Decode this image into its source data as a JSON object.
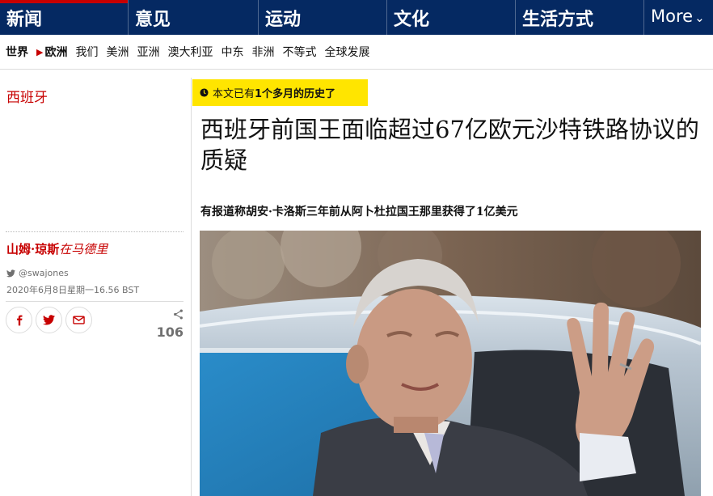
{
  "topnav": {
    "pillars": [
      {
        "label": "新闻",
        "active": true
      },
      {
        "label": "意见",
        "active": false
      },
      {
        "label": "运动",
        "active": false
      },
      {
        "label": "文化",
        "active": false
      },
      {
        "label": "生活方式",
        "active": false
      }
    ],
    "more_label": "More",
    "accent_color": "#c70000",
    "background_color": "#052962"
  },
  "subnav": {
    "items": [
      "世界",
      "欧洲",
      "我们",
      "美洲",
      "亚洲",
      "澳大利亚",
      "中东",
      "非洲",
      "不等式",
      "全球发展"
    ]
  },
  "article": {
    "section": "西班牙",
    "age_notice": {
      "prefix": "本文已有",
      "emphasis": "1个多月的历史了"
    },
    "badge_color": "#ffe500",
    "headline": "西班牙前国王面临超过67亿欧元沙特铁路协议的质疑",
    "standfirst": "有报道称胡安·卡洛斯三年前从阿卜杜拉国王那里获得了1亿美元",
    "byline": {
      "author": "山姆·琼斯",
      "location": "在马德里"
    },
    "twitter_handle": "@swajones",
    "dateline": "2020年6月8日星期一16.56 BST",
    "share_count": "106",
    "share_buttons": [
      "facebook-icon",
      "twitter-icon",
      "email-icon"
    ]
  }
}
